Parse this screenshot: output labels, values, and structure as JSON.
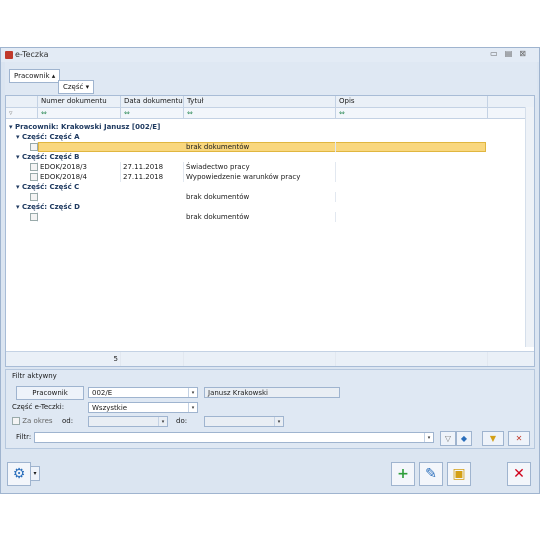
{
  "window": {
    "title": "e-Teczka"
  },
  "grouping": {
    "level1": "Pracownik",
    "level2": "Część"
  },
  "grid": {
    "columns": [
      "Numer dokumentu",
      "Data dokumentu",
      "Tytuł",
      "Opis"
    ],
    "filter_row": {
      "c0": "⇔",
      "c1": "⇔",
      "c2": "⇔",
      "c3": "⇔"
    },
    "group": "Pracownik: Krakowski Janusz [002/E]",
    "parts": [
      {
        "label": "Część: Część A",
        "rows": [
          {
            "num": "",
            "date": "",
            "title": "brak dokumentów"
          }
        ]
      },
      {
        "label": "Część: Część B",
        "rows": [
          {
            "num": "EDOK/2018/3",
            "date": "27.11.2018",
            "title": "Świadectwo pracy"
          },
          {
            "num": "EDOK/2018/4",
            "date": "27.11.2018",
            "title": "Wypowiedzenie warunków pracy"
          }
        ]
      },
      {
        "label": "Część: Część C",
        "rows": [
          {
            "num": "",
            "date": "",
            "title": "brak dokumentów"
          }
        ]
      },
      {
        "label": "Część: Część D",
        "rows": [
          {
            "num": "",
            "date": "",
            "title": "brak dokumentów"
          }
        ]
      }
    ],
    "count": "5"
  },
  "filter": {
    "heading": "Filtr aktywny",
    "employee_button": "Pracownik",
    "employee_code": "002/E",
    "employee_name": "Janusz Krakowski",
    "part_label": "Część e-Teczki:",
    "part_value": "Wszystkie",
    "period_label": "Za okres",
    "from_label": "od:",
    "to_label": "do:",
    "filter_label": "Filtr:"
  },
  "colors": {
    "accent": "#dbe5f1",
    "highlight": "#f9d77e"
  }
}
